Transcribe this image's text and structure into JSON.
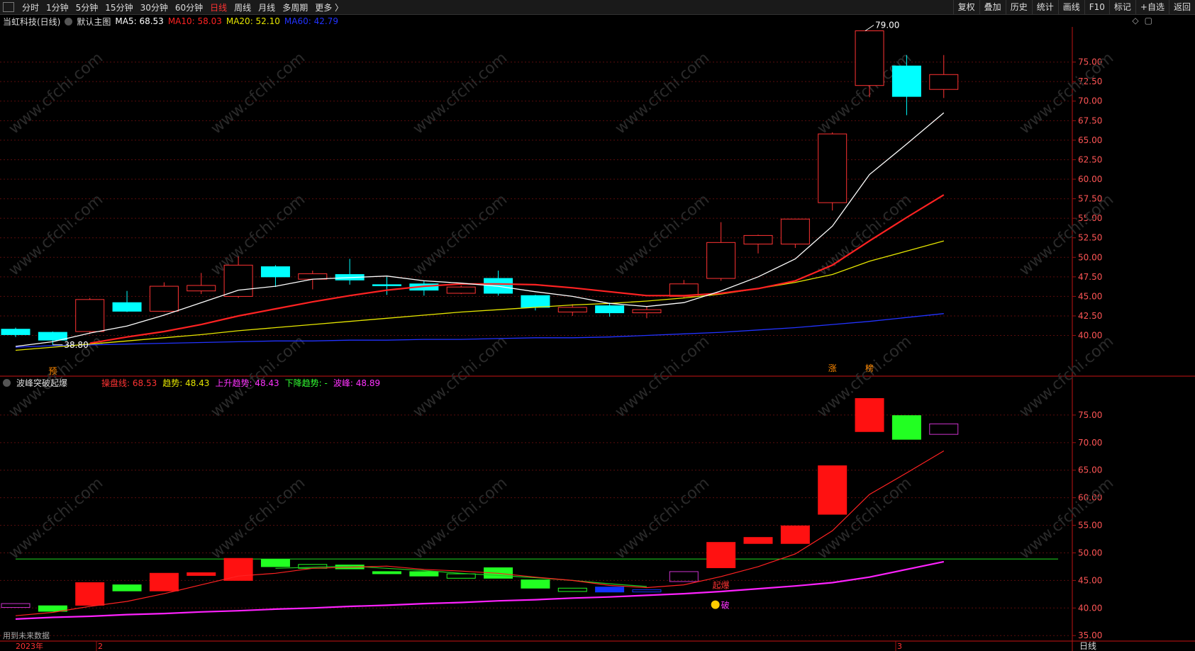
{
  "toolbar": {
    "periods": [
      "分时",
      "1分钟",
      "5分钟",
      "15分钟",
      "30分钟",
      "60分钟",
      "日线",
      "周线",
      "月线",
      "多周期",
      "更多 〉"
    ],
    "active_period_index": 6,
    "tools": [
      "复权",
      "叠加",
      "历史",
      "统计",
      "画线",
      "F10",
      "标记",
      "+自选",
      "返回"
    ]
  },
  "main_chart": {
    "stock_title": "当虹科技(日线)",
    "template_label": "默认主图",
    "ma5": {
      "label": "MA5: 68.53",
      "color": "#ffffff"
    },
    "ma10": {
      "label": "MA10: 58.03",
      "color": "#ff2222"
    },
    "ma20": {
      "label": "MA20: 52.10",
      "color": "#e6e600"
    },
    "ma60": {
      "label": "MA60: 42.79",
      "color": "#2233ff"
    },
    "high_label": "79.00",
    "low_label": "38.80",
    "markers": [
      "预",
      "涨",
      "榜"
    ],
    "yticks": [
      "75.00",
      "72.50",
      "70.00",
      "67.50",
      "65.00",
      "62.50",
      "60.00",
      "57.50",
      "55.00",
      "52.50",
      "50.00",
      "47.50",
      "45.00",
      "42.50",
      "40.00"
    ]
  },
  "sub_chart": {
    "name": "波峰突破起爆",
    "op_line": {
      "label": "操盘线: 68.53",
      "color": "#ff3333"
    },
    "trend": {
      "label": "趋势: 48.43",
      "color": "#e6e600"
    },
    "up_trend": {
      "label": "上升趋势: 48.43",
      "color": "#ff33ff"
    },
    "down_trend": {
      "label": "下降趋势: -",
      "color": "#33ff33"
    },
    "peak": {
      "label": "波峰: 48.89",
      "color": "#ff33ff"
    },
    "signal_qibao": "起爆",
    "signal_break": "破",
    "yticks": [
      "75.00",
      "70.00",
      "65.00",
      "60.00",
      "55.00",
      "50.00",
      "45.00",
      "40.00",
      "35.00"
    ],
    "note": "用到未来数据"
  },
  "x_axis": {
    "year_label": "2023年",
    "month_2": "2",
    "month_3": "3",
    "period_label": "日线"
  },
  "chart_data": {
    "type": "candlestick",
    "candles": [
      {
        "o": 40.8,
        "c": 40.1,
        "h": 41.0,
        "l": 39.8
      },
      {
        "o": 40.4,
        "c": 39.4,
        "h": 40.5,
        "l": 38.8
      },
      {
        "o": 40.5,
        "c": 44.6,
        "h": 44.8,
        "l": 40.2
      },
      {
        "o": 44.2,
        "c": 43.1,
        "h": 45.7,
        "l": 43.0
      },
      {
        "o": 43.1,
        "c": 46.3,
        "h": 46.8,
        "l": 43.0
      },
      {
        "o": 45.7,
        "c": 46.4,
        "h": 48.0,
        "l": 45.3
      },
      {
        "o": 45.0,
        "c": 49.0,
        "h": 50.1,
        "l": 44.8
      },
      {
        "o": 48.8,
        "c": 47.5,
        "h": 49.0,
        "l": 46.2
      },
      {
        "o": 47.2,
        "c": 47.9,
        "h": 48.3,
        "l": 45.9
      },
      {
        "o": 47.8,
        "c": 47.1,
        "h": 49.8,
        "l": 46.5
      },
      {
        "o": 46.5,
        "c": 46.4,
        "h": 47.5,
        "l": 45.2
      },
      {
        "o": 46.6,
        "c": 45.8,
        "h": 47.0,
        "l": 45.1
      },
      {
        "o": 45.4,
        "c": 46.2,
        "h": 46.4,
        "l": 45.3
      },
      {
        "o": 47.3,
        "c": 45.4,
        "h": 48.3,
        "l": 45.1
      },
      {
        "o": 45.1,
        "c": 43.6,
        "h": 45.2,
        "l": 43.2
      },
      {
        "o": 43.0,
        "c": 43.6,
        "h": 44.0,
        "l": 42.5
      },
      {
        "o": 43.8,
        "c": 42.9,
        "h": 44.2,
        "l": 42.4
      },
      {
        "o": 42.9,
        "c": 43.3,
        "h": 43.7,
        "l": 42.2
      },
      {
        "o": 45.0,
        "c": 46.6,
        "h": 47.1,
        "l": 44.8
      },
      {
        "o": 47.3,
        "c": 51.9,
        "h": 54.5,
        "l": 47.0
      },
      {
        "o": 51.7,
        "c": 52.8,
        "h": 52.9,
        "l": 50.5
      },
      {
        "o": 51.7,
        "c": 54.9,
        "h": 54.9,
        "l": 51.2
      },
      {
        "o": 57.0,
        "c": 65.8,
        "h": 66.0,
        "l": 56.0
      },
      {
        "o": 72.0,
        "c": 79.0,
        "h": 79.0,
        "l": 70.5
      },
      {
        "o": 74.5,
        "c": 70.6,
        "h": 75.9,
        "l": 68.2
      },
      {
        "o": 71.5,
        "c": 73.4,
        "h": 75.9,
        "l": 70.4
      }
    ],
    "ma5": [
      38.6,
      39.2,
      40.3,
      41.2,
      42.6,
      44.2,
      45.8,
      46.3,
      47.2,
      47.4,
      47.6,
      47.0,
      46.7,
      46.3,
      45.6,
      45.0,
      44.1,
      43.7,
      44.2,
      45.7,
      47.5,
      49.8,
      54.0,
      60.6,
      64.5,
      68.5
    ],
    "ma10": [
      null,
      null,
      39.0,
      39.8,
      40.5,
      41.4,
      42.5,
      43.4,
      44.3,
      45.1,
      45.8,
      46.3,
      46.6,
      46.6,
      46.5,
      46.1,
      45.6,
      45.1,
      45.1,
      45.4,
      46.0,
      47.0,
      49.0,
      52.1,
      55.1,
      58.0
    ],
    "ma20": [
      38.1,
      38.5,
      38.9,
      39.3,
      39.7,
      40.1,
      40.6,
      41.0,
      41.4,
      41.8,
      42.2,
      42.6,
      43.0,
      43.3,
      43.6,
      43.9,
      44.1,
      44.4,
      44.8,
      45.3,
      46.0,
      46.8,
      47.8,
      49.5,
      50.8,
      52.1
    ],
    "ma60": [
      38.5,
      38.7,
      38.8,
      38.9,
      39.0,
      39.1,
      39.2,
      39.3,
      39.3,
      39.4,
      39.4,
      39.5,
      39.5,
      39.6,
      39.7,
      39.7,
      39.8,
      40.0,
      40.2,
      40.4,
      40.7,
      41.0,
      41.4,
      41.8,
      42.3,
      42.8
    ],
    "sub_bars": [
      {
        "o": 40.8,
        "c": 40.1,
        "color": "#cc33cc",
        "fill": false
      },
      {
        "o": 40.4,
        "c": 39.4,
        "color": "#22ff22",
        "fill": true
      },
      {
        "o": 40.5,
        "c": 44.6,
        "color": "#ff1111",
        "fill": true
      },
      {
        "o": 44.2,
        "c": 43.1,
        "color": "#22ff22",
        "fill": true
      },
      {
        "o": 43.1,
        "c": 46.3,
        "color": "#ff1111",
        "fill": true
      },
      {
        "o": 45.9,
        "c": 46.4,
        "color": "#ff1111",
        "fill": true
      },
      {
        "o": 45.0,
        "c": 49.0,
        "color": "#ff1111",
        "fill": true
      },
      {
        "o": 48.8,
        "c": 47.5,
        "color": "#22ff22",
        "fill": true
      },
      {
        "o": 47.2,
        "c": 47.9,
        "color": "#22ff22",
        "fill": false
      },
      {
        "o": 47.8,
        "c": 47.1,
        "color": "#22ff22",
        "fill": true
      },
      {
        "o": 46.6,
        "c": 46.4,
        "color": "#22ff22",
        "fill": true
      },
      {
        "o": 46.6,
        "c": 45.8,
        "color": "#22ff22",
        "fill": true
      },
      {
        "o": 45.4,
        "c": 46.2,
        "color": "#22ff22",
        "fill": false
      },
      {
        "o": 47.3,
        "c": 45.4,
        "color": "#22ff22",
        "fill": true
      },
      {
        "o": 45.1,
        "c": 43.6,
        "color": "#22ff22",
        "fill": true
      },
      {
        "o": 43.0,
        "c": 43.6,
        "color": "#22ff22",
        "fill": false
      },
      {
        "o": 43.8,
        "c": 42.9,
        "color": "#1133ff",
        "fill": true
      },
      {
        "o": 43.0,
        "c": 43.3,
        "color": "#1133ff",
        "fill": false
      },
      {
        "o": 44.8,
        "c": 46.6,
        "color": "#cc33cc",
        "fill": false
      },
      {
        "o": 47.3,
        "c": 51.9,
        "color": "#ff1111",
        "fill": true
      },
      {
        "o": 51.7,
        "c": 52.8,
        "color": "#ff1111",
        "fill": true
      },
      {
        "o": 51.7,
        "c": 54.9,
        "color": "#ff1111",
        "fill": true
      },
      {
        "o": 57.0,
        "c": 65.8,
        "color": "#ff1111",
        "fill": true
      },
      {
        "o": 72.0,
        "c": 78.0,
        "color": "#ff1111",
        "fill": true
      },
      {
        "o": 74.9,
        "c": 70.6,
        "color": "#22ff22",
        "fill": true
      },
      {
        "o": 71.5,
        "c": 73.4,
        "color": "#cc33cc",
        "fill": false
      }
    ],
    "op_line": [
      38.6,
      39.2,
      40.3,
      41.2,
      42.6,
      44.2,
      45.8,
      46.3,
      47.2,
      47.4,
      47.6,
      47.0,
      46.7,
      46.3,
      45.6,
      45.0,
      44.1,
      43.7,
      44.2,
      45.7,
      47.5,
      49.8,
      54.0,
      60.6,
      64.5,
      68.5
    ],
    "trend_line": [
      38.0,
      38.3,
      38.5,
      38.8,
      39.0,
      39.3,
      39.5,
      39.8,
      40.0,
      40.3,
      40.5,
      40.8,
      41.0,
      41.3,
      41.5,
      41.8,
      42.0,
      42.3,
      42.6,
      43.0,
      43.5,
      44.0,
      44.6,
      45.6,
      47.0,
      48.4
    ],
    "down_trend_line": [
      null,
      null,
      null,
      null,
      null,
      null,
      null,
      47.2,
      47.4,
      47.6,
      47.2,
      46.8,
      46.3,
      45.9,
      45.5,
      45.0,
      44.4,
      43.9,
      null,
      null,
      null,
      null,
      null,
      null,
      null,
      null
    ],
    "peak_level": 48.89,
    "main_ylim": [
      37.6,
      79.5
    ],
    "sub_ylim": [
      34.0,
      80.0
    ]
  }
}
